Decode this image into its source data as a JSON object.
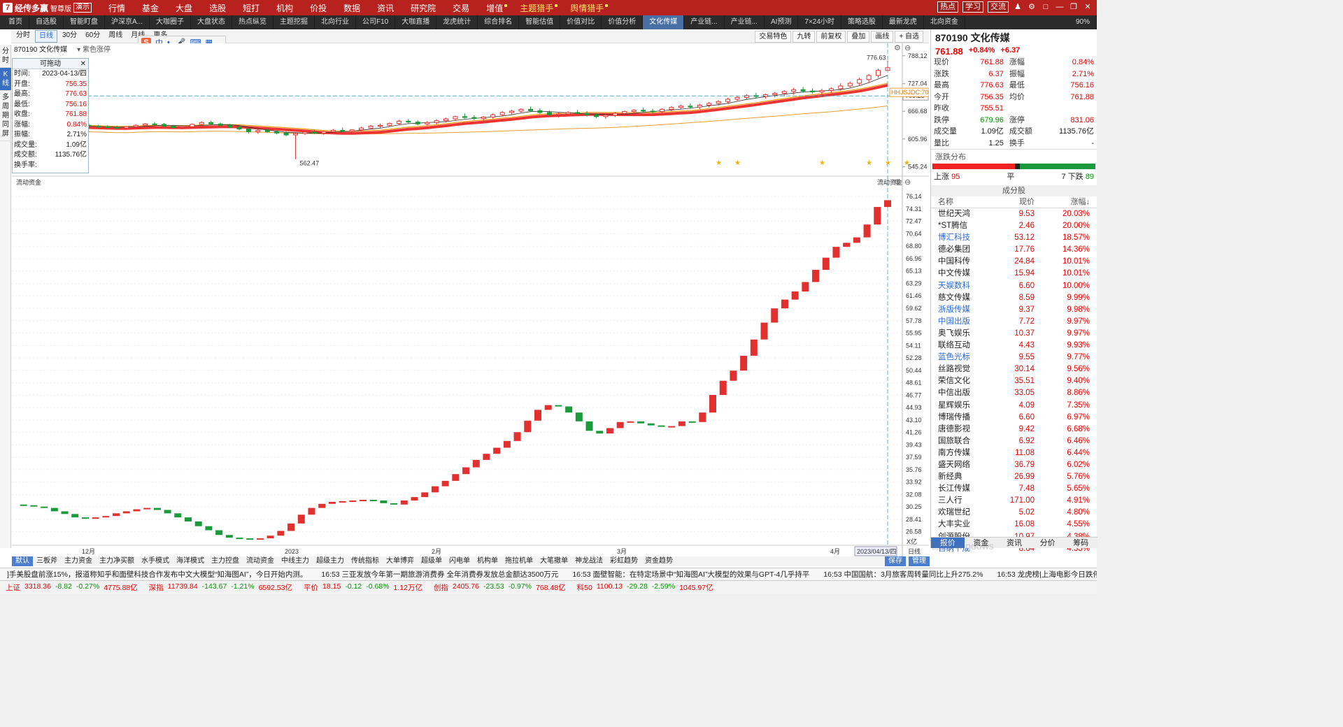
{
  "app": {
    "logo": "经传多赢",
    "edition": "智尊版",
    "demo": "演示",
    "menu": [
      "行情",
      "基金",
      "大盘",
      "选股",
      "短打",
      "机构",
      "价投",
      "数据",
      "资讯",
      "研究院",
      "交易",
      "增值",
      "主题猎手",
      "舆情猎手"
    ],
    "top_buttons": [
      "热点",
      "学习",
      "交流"
    ]
  },
  "tabs": [
    "首页",
    "自选股",
    "智能盯盘",
    "沪深京A...",
    "大咖圈子",
    "大盘状态",
    "热点纵览",
    "主题挖掘",
    "北向行业",
    "公司F10",
    "大咖直播",
    "龙虎统计",
    "综合排名",
    "智能估值",
    "价值对比",
    "价值分析",
    "文化传媒",
    "产业链...",
    "产业链...",
    "AI预测",
    "7×24小时",
    "策略选股",
    "最新龙虎",
    "北向资金"
  ],
  "active_tab": "文化传媒",
  "zoom": "90%",
  "vertical_bar": [
    "分时",
    "K线",
    "多周期同屏"
  ],
  "chart_toolbar": {
    "periods": [
      "分时",
      "日线",
      "30分",
      "60分",
      "周线",
      "月线",
      "更多"
    ],
    "active_period": "日线",
    "right_buttons": [
      "交易特色",
      "九转",
      "前复权",
      "叠加",
      "画线",
      "+ 自选"
    ]
  },
  "chart_header": {
    "code_name": "870190 文化传媒",
    "indicator": "紫色涨停"
  },
  "info_box": {
    "title": "可拖动",
    "rows": [
      {
        "k": "时间:",
        "v": "2023-04-13/四"
      },
      {
        "k": "开盘:",
        "v": "756.35"
      },
      {
        "k": "最高:",
        "v": "776.63"
      },
      {
        "k": "最低:",
        "v": "756.16"
      },
      {
        "k": "收盘:",
        "v": "761.88"
      },
      {
        "k": "涨幅:",
        "v": "0.84%"
      },
      {
        "k": "振幅:",
        "v": "2.71%"
      },
      {
        "k": "成交量:",
        "v": "1.09亿"
      },
      {
        "k": "成交额:",
        "v": "1135.76亿"
      },
      {
        "k": "换手率:",
        "v": ""
      }
    ]
  },
  "kline": {
    "price_axis": [
      "788.12",
      "727.04",
      "666.68",
      "605.96",
      "545.24"
    ],
    "crosshair_label": "700.28",
    "max_label": "776.63",
    "min_label": "562.47",
    "ma_label": "HHJSJDC:707.9",
    "candles": [
      [
        636,
        640,
        631,
        634
      ],
      [
        634,
        637,
        630,
        633
      ],
      [
        633,
        636,
        629,
        631
      ],
      [
        631,
        635,
        628,
        630
      ],
      [
        630,
        634,
        627,
        633
      ],
      [
        633,
        638,
        631,
        636
      ],
      [
        636,
        641,
        634,
        639
      ],
      [
        639,
        643,
        636,
        638
      ],
      [
        638,
        641,
        632,
        634
      ],
      [
        634,
        637,
        629,
        631
      ],
      [
        631,
        635,
        628,
        633
      ],
      [
        633,
        640,
        631,
        638
      ],
      [
        638,
        645,
        636,
        642
      ],
      [
        642,
        646,
        637,
        639
      ],
      [
        639,
        642,
        633,
        636
      ],
      [
        636,
        639,
        630,
        632
      ],
      [
        632,
        634,
        625,
        628
      ],
      [
        628,
        631,
        618,
        622
      ],
      [
        622,
        627,
        617,
        625
      ],
      [
        625,
        629,
        620,
        622
      ],
      [
        622,
        626,
        616,
        619
      ],
      [
        619,
        623,
        612,
        615
      ],
      [
        615,
        620,
        562,
        618
      ],
      [
        618,
        624,
        615,
        621
      ],
      [
        621,
        626,
        617,
        619
      ],
      [
        619,
        624,
        615,
        622
      ],
      [
        622,
        628,
        619,
        625
      ],
      [
        625,
        631,
        621,
        623
      ],
      [
        623,
        627,
        618,
        626
      ],
      [
        626,
        633,
        623,
        630
      ],
      [
        630,
        637,
        627,
        634
      ],
      [
        634,
        640,
        630,
        636
      ],
      [
        636,
        642,
        633,
        640
      ],
      [
        640,
        648,
        636,
        645
      ],
      [
        645,
        650,
        640,
        643
      ],
      [
        643,
        647,
        636,
        639
      ],
      [
        639,
        645,
        635,
        642
      ],
      [
        642,
        649,
        638,
        646
      ],
      [
        646,
        653,
        642,
        650
      ],
      [
        650,
        657,
        646,
        655
      ],
      [
        655,
        662,
        651,
        653
      ],
      [
        653,
        658,
        647,
        651
      ],
      [
        651,
        656,
        645,
        654
      ],
      [
        654,
        662,
        650,
        659
      ],
      [
        659,
        667,
        655,
        664
      ],
      [
        664,
        670,
        659,
        667
      ],
      [
        667,
        673,
        662,
        671
      ],
      [
        671,
        677,
        665,
        668
      ],
      [
        668,
        673,
        660,
        664
      ],
      [
        664,
        668,
        655,
        659
      ],
      [
        659,
        664,
        653,
        661
      ],
      [
        661,
        667,
        656,
        664
      ],
      [
        664,
        670,
        658,
        662
      ],
      [
        662,
        667,
        655,
        659
      ],
      [
        659,
        663,
        652,
        655
      ],
      [
        655,
        661,
        650,
        658
      ],
      [
        658,
        665,
        654,
        662
      ],
      [
        662,
        668,
        658,
        666
      ],
      [
        666,
        671,
        661,
        669
      ],
      [
        669,
        675,
        664,
        667
      ],
      [
        667,
        672,
        661,
        666
      ],
      [
        666,
        673,
        662,
        671
      ],
      [
        671,
        678,
        667,
        675
      ],
      [
        675,
        681,
        670,
        678
      ],
      [
        678,
        684,
        672,
        676
      ],
      [
        676,
        683,
        671,
        680
      ],
      [
        680,
        687,
        675,
        684
      ],
      [
        684,
        691,
        679,
        688
      ],
      [
        688,
        696,
        683,
        693
      ],
      [
        693,
        700,
        688,
        697
      ],
      [
        697,
        704,
        692,
        701
      ],
      [
        701,
        707,
        695,
        699
      ],
      [
        699,
        705,
        694,
        703
      ],
      [
        703,
        709,
        697,
        706
      ],
      [
        706,
        713,
        700,
        710
      ],
      [
        710,
        718,
        703,
        714
      ],
      [
        714,
        720,
        707,
        711
      ],
      [
        711,
        717,
        705,
        709
      ],
      [
        709,
        716,
        703,
        712
      ],
      [
        712,
        719,
        707,
        716
      ],
      [
        716,
        728,
        712,
        722
      ],
      [
        722,
        732,
        717,
        728
      ],
      [
        728,
        740,
        723,
        736
      ],
      [
        736,
        748,
        730,
        745
      ],
      [
        745,
        760,
        740,
        756
      ],
      [
        756,
        777,
        756,
        762
      ]
    ]
  },
  "flow_panel": {
    "title": "流动资金",
    "axis": [
      "76.14",
      "74.31",
      "72.47",
      "70.64",
      "68.80",
      "66.96",
      "65.13",
      "63.29",
      "61.46",
      "59.62",
      "57.78",
      "55.95",
      "54.11",
      "52.28",
      "50.44",
      "48.61",
      "46.77",
      "44.93",
      "43.10",
      "41.26",
      "39.43",
      "37.59",
      "35.76",
      "33.92",
      "32.08",
      "30.25",
      "28.41",
      "26.58",
      "X亿"
    ],
    "unit": "X亿",
    "values": [
      30.6,
      30.5,
      30.3,
      30.1,
      29.6,
      29.2,
      28.7,
      28.6,
      28.7,
      28.9,
      29.3,
      29.6,
      29.9,
      30.1,
      29.8,
      29.3,
      28.7,
      28.1,
      27.4,
      26.8,
      26.1,
      25.7,
      25.6,
      25.5,
      25.6,
      26.0,
      26.7,
      27.8,
      29.1,
      30.1,
      30.7,
      31.0,
      31.1,
      31.2,
      31.3,
      31.2,
      30.8,
      30.6,
      31.2,
      31.7,
      32.4,
      33.3,
      34.1,
      35.1,
      36.1,
      37.2,
      38.1,
      39.0,
      40.0,
      41.3,
      43.0,
      44.6,
      45.3,
      45.1,
      44.2,
      42.9,
      41.5,
      41.1,
      41.9,
      42.8,
      42.9,
      42.6,
      42.3,
      42.1,
      42.2,
      42.9,
      42.8,
      44.2,
      46.8,
      48.9,
      50.4,
      52.6,
      55.0,
      57.5,
      59.6,
      60.9,
      62.1,
      63.5,
      65.3,
      67.1,
      68.7,
      69.3,
      70.1,
      72.0,
      74.6,
      75.6
    ],
    "months": [
      "12月",
      "2023",
      "2月",
      "3月",
      "4月"
    ],
    "date_label": "2023/04/13/四",
    "period_label": "日线"
  },
  "right_panel": {
    "title": "870190 文化传媒",
    "price": "761.88",
    "change_pct": "+0.84%",
    "change": "+6.37",
    "quote": [
      {
        "k1": "现价",
        "v1": "761.88",
        "k2": "涨幅",
        "v2": "0.84%"
      },
      {
        "k1": "涨跌",
        "v1": "6.37",
        "k2": "振幅",
        "v2": "2.71%"
      },
      {
        "k1": "最高",
        "v1": "776.63",
        "k2": "最低",
        "v2": "756.16"
      },
      {
        "k1": "今开",
        "v1": "756.35",
        "k2": "均价",
        "v2": "761.88"
      },
      {
        "k1": "昨收",
        "v1": "755.51",
        "k2": "",
        "v2": ""
      },
      {
        "k1": "跌停",
        "v1": "679.96",
        "k2": "涨停",
        "v2": "831.06"
      },
      {
        "k1": "成交量",
        "v1": "1.09亿",
        "k2": "成交额",
        "v2": "1135.76亿"
      },
      {
        "k1": "量比",
        "v1": "1.25",
        "k2": "换手",
        "v2": "-"
      }
    ],
    "dist_title": "涨跌分布",
    "dist": {
      "up_label": "上涨",
      "up": "95",
      "flat_label": "平",
      "flat": "7",
      "down_label": "下跌",
      "down": "89"
    },
    "constituents_title": "成分股",
    "constituents_headers": [
      "名称",
      "现价",
      "涨幅↓"
    ],
    "constituents": [
      {
        "n": "世纪天鸿",
        "p": "9.53",
        "c": "20.03%",
        "blue": false
      },
      {
        "n": "*ST腾信",
        "p": "2.46",
        "c": "20.00%",
        "blue": false
      },
      {
        "n": "博汇科技",
        "p": "53.12",
        "c": "18.57%",
        "blue": true
      },
      {
        "n": "德必集团",
        "p": "17.76",
        "c": "14.36%",
        "blue": false
      },
      {
        "n": "中国科传",
        "p": "24.84",
        "c": "10.01%",
        "blue": false
      },
      {
        "n": "中文传媒",
        "p": "15.94",
        "c": "10.01%",
        "blue": false
      },
      {
        "n": "天娱数科",
        "p": "6.60",
        "c": "10.00%",
        "blue": true
      },
      {
        "n": "慈文传媒",
        "p": "8.59",
        "c": "9.99%",
        "blue": false
      },
      {
        "n": "浙版传媒",
        "p": "9.37",
        "c": "9.98%",
        "blue": true
      },
      {
        "n": "中国出版",
        "p": "7.72",
        "c": "9.97%",
        "blue": true
      },
      {
        "n": "奥飞娱乐",
        "p": "10.37",
        "c": "9.97%",
        "blue": false
      },
      {
        "n": "联络互动",
        "p": "4.43",
        "c": "9.93%",
        "blue": false
      },
      {
        "n": "蓝色光标",
        "p": "9.55",
        "c": "9.77%",
        "blue": true
      },
      {
        "n": "丝路视觉",
        "p": "30.14",
        "c": "9.56%",
        "blue": false
      },
      {
        "n": "荣信文化",
        "p": "35.51",
        "c": "9.40%",
        "blue": false
      },
      {
        "n": "中信出版",
        "p": "33.05",
        "c": "8.86%",
        "blue": false
      },
      {
        "n": "星辉娱乐",
        "p": "4.09",
        "c": "7.35%",
        "blue": false
      },
      {
        "n": "博瑞传播",
        "p": "6.60",
        "c": "6.97%",
        "blue": false
      },
      {
        "n": "唐德影视",
        "p": "9.42",
        "c": "6.68%",
        "blue": false
      },
      {
        "n": "国旅联合",
        "p": "6.92",
        "c": "6.46%",
        "blue": false
      },
      {
        "n": "南方传媒",
        "p": "11.08",
        "c": "6.44%",
        "blue": false
      },
      {
        "n": "盛天网络",
        "p": "36.79",
        "c": "6.02%",
        "blue": false
      },
      {
        "n": "新经典",
        "p": "26.99",
        "c": "5.76%",
        "blue": false
      },
      {
        "n": "长江传媒",
        "p": "7.48",
        "c": "5.65%",
        "blue": false
      },
      {
        "n": "三人行",
        "p": "171.00",
        "c": "4.91%",
        "blue": false
      },
      {
        "n": "欢瑞世纪",
        "p": "5.02",
        "c": "4.80%",
        "blue": false
      },
      {
        "n": "大丰实业",
        "p": "16.08",
        "c": "4.55%",
        "blue": false
      },
      {
        "n": "创源股份",
        "p": "10.97",
        "c": "4.38%",
        "blue": false
      },
      {
        "n": "百纳千成",
        "p": "8.64",
        "c": "4.35%",
        "blue": true
      }
    ],
    "tabs": [
      "报价",
      "资金",
      "资讯",
      "分价",
      "筹码"
    ]
  },
  "watermark": [
    "激活 Windows",
    "转到\"设置\"以激活 Windows。"
  ],
  "indicator_tabs": [
    "默认",
    "三板斧",
    "主力资金",
    "主力净买额",
    "水手模式",
    "海洋模式",
    "主力控盘",
    "流动资金",
    "中线主力",
    "超级主力",
    "传统指标",
    "大单博弈",
    "超级单",
    "闪电单",
    "机构单",
    "拖拉机单",
    "大笔撤单",
    "神龙战法",
    "彩虹趋势",
    "资金趋势"
  ],
  "indicator_right": [
    "保存",
    "管理"
  ],
  "news": [
    "]手美股盘前涨15%，报道称知乎和面壁科技合作发布中文大模型“知海图AI”，今日开始内测。",
    "16:53 三亚发放今年第一期旅游消费券 全年消费券发放总金额达3500万元",
    "16:53 面壁智能：在特定场景中“知海图AI”大模型的效果与GPT-4几乎持平",
    "16:53 中国国航：3月旅客周转量同比上升275.2%",
    "16:53 龙虎榜|上海电影今日跌停 二机"
  ],
  "status": [
    {
      "name": "上证",
      "v": "3318.36",
      "c": "-8.82",
      "p": "-0.27%",
      "a": "4775.88亿"
    },
    {
      "name": "深指",
      "v": "11739.84",
      "c": "-143.67",
      "p": "-1.21%",
      "a": "6592.53亿"
    },
    {
      "name": "平价",
      "v": "18.15",
      "c": "-0.12",
      "p": "-0.68%",
      "a": "1.12万亿"
    },
    {
      "name": "创指",
      "v": "2405.76",
      "c": "-23.53",
      "p": "-0.97%",
      "a": "768.48亿"
    },
    {
      "name": "科50",
      "v": "1100.13",
      "c": "-29.28",
      "p": "-2.59%",
      "a": "1045.97亿"
    }
  ]
}
